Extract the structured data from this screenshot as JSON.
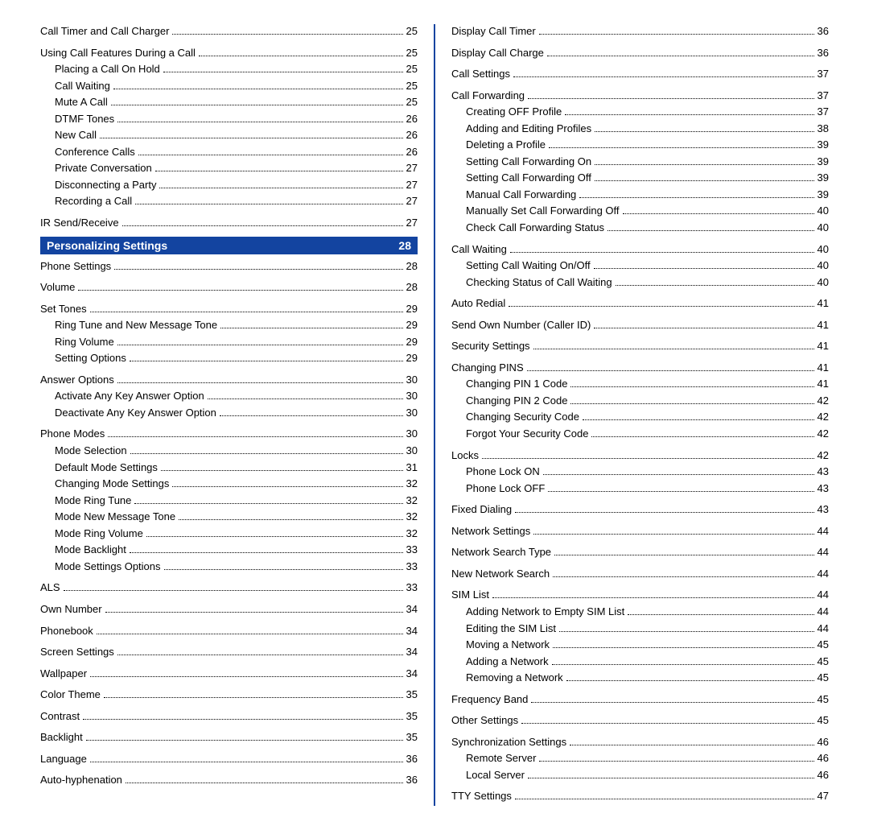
{
  "left": [
    {
      "t": "item",
      "label": "Call Timer and Call Charger",
      "pg": "25",
      "indent": 0
    },
    {
      "t": "spacer"
    },
    {
      "t": "item",
      "label": "Using Call Features During a Call",
      "pg": "25",
      "indent": 0
    },
    {
      "t": "item",
      "label": "Placing a Call On Hold",
      "pg": "25",
      "indent": 1
    },
    {
      "t": "item",
      "label": "Call Waiting",
      "pg": "25",
      "indent": 1
    },
    {
      "t": "item",
      "label": "Mute A Call",
      "pg": "25",
      "indent": 1
    },
    {
      "t": "item",
      "label": "DTMF Tones",
      "pg": "26",
      "indent": 1
    },
    {
      "t": "item",
      "label": "New Call",
      "pg": "26",
      "indent": 1
    },
    {
      "t": "item",
      "label": "Conference Calls",
      "pg": "26",
      "indent": 1
    },
    {
      "t": "item",
      "label": "Private Conversation",
      "pg": "27",
      "indent": 1
    },
    {
      "t": "item",
      "label": "Disconnecting a Party",
      "pg": "27",
      "indent": 1
    },
    {
      "t": "item",
      "label": "Recording a Call",
      "pg": "27",
      "indent": 1
    },
    {
      "t": "spacer"
    },
    {
      "t": "item",
      "label": "IR Send/Receive",
      "pg": "27",
      "indent": 0
    },
    {
      "t": "section",
      "label": "Personalizing Settings",
      "pg": "28"
    },
    {
      "t": "item",
      "label": "Phone Settings",
      "pg": "28",
      "indent": 0
    },
    {
      "t": "spacer"
    },
    {
      "t": "item",
      "label": "Volume",
      "pg": "28",
      "indent": 0
    },
    {
      "t": "spacer"
    },
    {
      "t": "item",
      "label": "Set Tones",
      "pg": "29",
      "indent": 0
    },
    {
      "t": "item",
      "label": "Ring Tune and New Message Tone",
      "pg": "29",
      "indent": 1
    },
    {
      "t": "item",
      "label": "Ring Volume",
      "pg": "29",
      "indent": 1
    },
    {
      "t": "item",
      "label": "Setting Options",
      "pg": "29",
      "indent": 1
    },
    {
      "t": "spacer"
    },
    {
      "t": "item",
      "label": "Answer Options",
      "pg": "30",
      "indent": 0
    },
    {
      "t": "item",
      "label": "Activate Any Key Answer Option",
      "pg": "30",
      "indent": 1
    },
    {
      "t": "item",
      "label": "Deactivate Any Key Answer Option",
      "pg": "30",
      "indent": 1
    },
    {
      "t": "spacer"
    },
    {
      "t": "item",
      "label": "Phone Modes",
      "pg": "30",
      "indent": 0
    },
    {
      "t": "item",
      "label": "Mode Selection",
      "pg": "30",
      "indent": 1
    },
    {
      "t": "item",
      "label": "Default Mode Settings",
      "pg": "31",
      "indent": 1
    },
    {
      "t": "item",
      "label": "Changing Mode Settings",
      "pg": "32",
      "indent": 1
    },
    {
      "t": "item",
      "label": "Mode Ring Tune",
      "pg": "32",
      "indent": 1
    },
    {
      "t": "item",
      "label": "Mode New Message Tone",
      "pg": "32",
      "indent": 1
    },
    {
      "t": "item",
      "label": "Mode Ring Volume",
      "pg": "32",
      "indent": 1
    },
    {
      "t": "item",
      "label": "Mode Backlight",
      "pg": "33",
      "indent": 1
    },
    {
      "t": "item",
      "label": "Mode Settings Options",
      "pg": "33",
      "indent": 1
    },
    {
      "t": "spacer"
    },
    {
      "t": "item",
      "label": "ALS",
      "pg": "33",
      "indent": 0
    },
    {
      "t": "spacer"
    },
    {
      "t": "item",
      "label": "Own Number",
      "pg": "34",
      "indent": 0
    },
    {
      "t": "spacer"
    },
    {
      "t": "item",
      "label": "Phonebook",
      "pg": "34",
      "indent": 0
    },
    {
      "t": "spacer"
    },
    {
      "t": "item",
      "label": "Screen Settings",
      "pg": "34",
      "indent": 0
    },
    {
      "t": "spacer"
    },
    {
      "t": "item",
      "label": "Wallpaper",
      "pg": "34",
      "indent": 0
    },
    {
      "t": "spacer"
    },
    {
      "t": "item",
      "label": "Color Theme",
      "pg": "35",
      "indent": 0
    },
    {
      "t": "spacer"
    },
    {
      "t": "item",
      "label": "Contrast",
      "pg": "35",
      "indent": 0
    },
    {
      "t": "spacer"
    },
    {
      "t": "item",
      "label": "Backlight",
      "pg": "35",
      "indent": 0
    },
    {
      "t": "spacer"
    },
    {
      "t": "item",
      "label": "Language",
      "pg": "36",
      "indent": 0
    },
    {
      "t": "spacer"
    },
    {
      "t": "item",
      "label": "Auto-hyphenation",
      "pg": "36",
      "indent": 0
    }
  ],
  "right": [
    {
      "t": "item",
      "label": "Display Call Timer",
      "pg": "36",
      "indent": 0
    },
    {
      "t": "spacer"
    },
    {
      "t": "item",
      "label": "Display Call Charge",
      "pg": "36",
      "indent": 0
    },
    {
      "t": "spacer"
    },
    {
      "t": "item",
      "label": "Call Settings",
      "pg": "37",
      "indent": 0
    },
    {
      "t": "spacer"
    },
    {
      "t": "item",
      "label": "Call Forwarding",
      "pg": "37",
      "indent": 0
    },
    {
      "t": "item",
      "label": "Creating OFF Profile",
      "pg": "37",
      "indent": 1
    },
    {
      "t": "item",
      "label": "Adding and Editing Profiles",
      "pg": "38",
      "indent": 1
    },
    {
      "t": "item",
      "label": "Deleting a Profile",
      "pg": "39",
      "indent": 1
    },
    {
      "t": "item",
      "label": "Setting Call Forwarding On",
      "pg": "39",
      "indent": 1
    },
    {
      "t": "item",
      "label": "Setting Call Forwarding Off",
      "pg": "39",
      "indent": 1
    },
    {
      "t": "item",
      "label": "Manual Call Forwarding",
      "pg": "39",
      "indent": 1
    },
    {
      "t": "item",
      "label": "Manually Set Call Forwarding Off",
      "pg": "40",
      "indent": 1
    },
    {
      "t": "item",
      "label": "Check Call Forwarding Status",
      "pg": "40",
      "indent": 1
    },
    {
      "t": "spacer"
    },
    {
      "t": "item",
      "label": "Call Waiting",
      "pg": "40",
      "indent": 0
    },
    {
      "t": "item",
      "label": "Setting Call Waiting On/Off",
      "pg": "40",
      "indent": 1
    },
    {
      "t": "item",
      "label": "Checking Status of Call Waiting",
      "pg": "40",
      "indent": 1
    },
    {
      "t": "spacer"
    },
    {
      "t": "item",
      "label": "Auto Redial",
      "pg": "41",
      "indent": 0
    },
    {
      "t": "spacer"
    },
    {
      "t": "item",
      "label": "Send Own Number (Caller ID)",
      "pg": "41",
      "indent": 0
    },
    {
      "t": "spacer"
    },
    {
      "t": "item",
      "label": "Security Settings",
      "pg": "41",
      "indent": 0
    },
    {
      "t": "spacer"
    },
    {
      "t": "item",
      "label": "Changing PINS",
      "pg": "41",
      "indent": 0
    },
    {
      "t": "item",
      "label": "Changing PIN 1 Code",
      "pg": "41",
      "indent": 1
    },
    {
      "t": "item",
      "label": "Changing  PIN 2 Code",
      "pg": "42",
      "indent": 1
    },
    {
      "t": "item",
      "label": "Changing Security Code",
      "pg": "42",
      "indent": 1
    },
    {
      "t": "item",
      "label": "Forgot Your Security Code",
      "pg": "42",
      "indent": 1
    },
    {
      "t": "spacer"
    },
    {
      "t": "item",
      "label": "Locks",
      "pg": "42",
      "indent": 0
    },
    {
      "t": "item",
      "label": "Phone Lock ON",
      "pg": "43",
      "indent": 1
    },
    {
      "t": "item",
      "label": "Phone Lock OFF",
      "pg": "43",
      "indent": 1
    },
    {
      "t": "spacer"
    },
    {
      "t": "item",
      "label": "Fixed Dialing",
      "pg": "43",
      "indent": 0
    },
    {
      "t": "spacer"
    },
    {
      "t": "item",
      "label": "Network Settings",
      "pg": "44",
      "indent": 0
    },
    {
      "t": "spacer"
    },
    {
      "t": "item",
      "label": "Network Search Type",
      "pg": "44",
      "indent": 0
    },
    {
      "t": "spacer"
    },
    {
      "t": "item",
      "label": "New Network Search",
      "pg": "44",
      "indent": 0
    },
    {
      "t": "spacer"
    },
    {
      "t": "item",
      "label": "SIM List",
      "pg": "44",
      "indent": 0
    },
    {
      "t": "item",
      "label": "Adding Network to Empty SIM List",
      "pg": "44",
      "indent": 1
    },
    {
      "t": "item",
      "label": "Editing the SIM List",
      "pg": "44",
      "indent": 1
    },
    {
      "t": "item",
      "label": "Moving a Network",
      "pg": "45",
      "indent": 1
    },
    {
      "t": "item",
      "label": "Adding a Network",
      "pg": "45",
      "indent": 1
    },
    {
      "t": "item",
      "label": "Removing a Network",
      "pg": "45",
      "indent": 1
    },
    {
      "t": "spacer"
    },
    {
      "t": "item",
      "label": "Frequency Band",
      "pg": "45",
      "indent": 0
    },
    {
      "t": "spacer"
    },
    {
      "t": "item",
      "label": "Other Settings",
      "pg": "45",
      "indent": 0
    },
    {
      "t": "spacer"
    },
    {
      "t": "item",
      "label": "Synchronization Settings",
      "pg": "46",
      "indent": 0
    },
    {
      "t": "item",
      "label": "Remote Server",
      "pg": "46",
      "indent": 1
    },
    {
      "t": "item",
      "label": "Local Server",
      "pg": "46",
      "indent": 1
    },
    {
      "t": "spacer"
    },
    {
      "t": "item",
      "label": "TTY Settings",
      "pg": "47",
      "indent": 0
    }
  ]
}
